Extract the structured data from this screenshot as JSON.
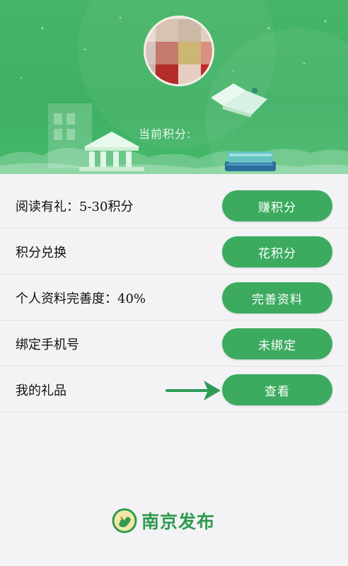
{
  "header": {
    "points_label": "当前积分:"
  },
  "rows": [
    {
      "label": "阅读有礼：5-30积分",
      "button": "赚积分"
    },
    {
      "label": "积分兑换",
      "button": "花积分"
    },
    {
      "label": "个人资料完善度：40%",
      "button": "完善资料"
    },
    {
      "label": "绑定手机号",
      "button": "未绑定"
    },
    {
      "label": "我的礼品",
      "button": "查看"
    }
  ],
  "footer": {
    "brand": "南京发布"
  },
  "colors": {
    "accent": "#3cab5f",
    "header_green": "#46b567",
    "brand_green": "#2f9a4f"
  },
  "icons": [
    "bank-building-icon",
    "book-stack-icon",
    "open-book-icon",
    "arrow-right-icon",
    "nanjing-logo-icon"
  ]
}
